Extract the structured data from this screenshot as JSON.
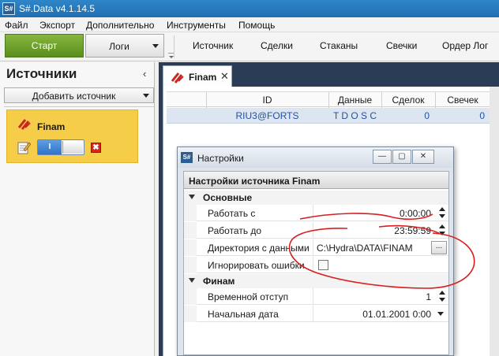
{
  "window": {
    "title": "S#.Data v4.1.14.5",
    "icon": "S#"
  },
  "menu": {
    "items": [
      "Файл",
      "Экспорт",
      "Дополнительно",
      "Инструменты",
      "Помощь"
    ]
  },
  "toolbar": {
    "start_label": "Старт",
    "logs_label": "Логи",
    "buttons": [
      "Источник",
      "Сделки",
      "Стаканы",
      "Свечки",
      "Ордер Лог"
    ]
  },
  "left_panel": {
    "title": "Источники",
    "add_source_label": "Добавить источник",
    "source": {
      "name": "Finam",
      "toggle_label": "I",
      "enabled": true
    }
  },
  "document": {
    "tab_label": "Finam",
    "grid": {
      "columns": [
        "ID",
        "Данные",
        "Сделок",
        "Свечек"
      ],
      "rows": [
        {
          "id": "RIU3@FORTS",
          "data": "T D O S C",
          "trades": "0",
          "candles": "0"
        }
      ]
    }
  },
  "settings_dialog": {
    "title": "Настройки",
    "icon": "S#",
    "header": "Настройки источника Finam",
    "categories": [
      {
        "name": "Основные",
        "rows": [
          {
            "label": "Работать с",
            "value": "0:00:00"
          },
          {
            "label": "Работать до",
            "value": "23:59:59"
          },
          {
            "label": "Директория с данными",
            "value": "C:\\Hydra\\DATA\\FINAM",
            "button": "..."
          },
          {
            "label": "Игнорировать ошибки",
            "checked": false
          }
        ]
      },
      {
        "name": "Финам",
        "rows": [
          {
            "label": "Временной отступ",
            "value": "1"
          },
          {
            "label": "Начальная дата",
            "value": "01.01.2001 0:00"
          }
        ]
      }
    ]
  },
  "colors": {
    "title_bar": "#1f6fb0",
    "start_button": "#6a9e2a",
    "source_card": "#f6cd48",
    "document_bg": "#2b3d56",
    "grid_row": "#dde6f0",
    "annotation": "#d81e1e"
  }
}
